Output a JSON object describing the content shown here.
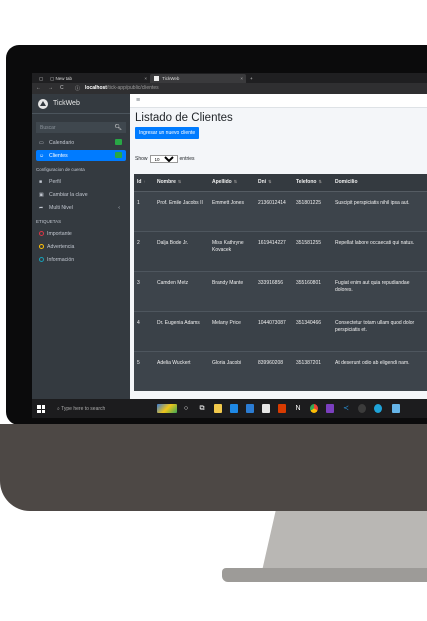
{
  "browser": {
    "tabs": [
      {
        "title": "New tab",
        "active": false
      },
      {
        "title": "TickWeb",
        "active": true
      }
    ],
    "new_tab_symbol": "+",
    "close_symbol": "×",
    "nav": {
      "back": "←",
      "forward": "→",
      "reload": "C",
      "info": "ⓘ"
    },
    "url_host": "localhost",
    "url_path": "/tick-app/public/clientes"
  },
  "sidebar": {
    "brand": "TickWeb",
    "search_placeholder": "Buscar",
    "items": [
      {
        "label": "Calendario",
        "icon": "calendar-icon",
        "badge_color": "#28a745",
        "active": false
      },
      {
        "label": "Clientes",
        "icon": "users-icon",
        "badge_color": "#28a745",
        "active": true
      }
    ],
    "config_header": "Configuracion de cuenta",
    "config_items": [
      {
        "label": "Perfil",
        "icon": "user-icon"
      },
      {
        "label": "Cambiar la clave",
        "icon": "lock-icon"
      },
      {
        "label": "Multi Nivel",
        "icon": "share-icon",
        "chevron": "‹"
      }
    ],
    "labels_header": "ETIQUETAS",
    "labels": [
      {
        "label": "Importante",
        "color": "#dc3545"
      },
      {
        "label": "Advertencia",
        "color": "#ffc107"
      },
      {
        "label": "Información",
        "color": "#17a2b8"
      }
    ]
  },
  "topnav": {
    "menu_symbol": "≡"
  },
  "main": {
    "title": "Listado de Clientes",
    "add_button": "Ingresar un nuevo cliente",
    "show_label": "Show",
    "show_value": "10",
    "entries_label": "entries",
    "table": {
      "headers": [
        "Id",
        "Nombre",
        "Apellido",
        "Dni",
        "Telefono",
        "Domicilio"
      ],
      "rows": [
        [
          "1",
          "Prof. Emile Jacobs II",
          "Emmett Jones",
          "2136012414",
          "351801225",
          "Suscipit perspiciatis nihil ipsa aut."
        ],
        [
          "2",
          "Dalja Bode Jr.",
          "Miss Kathryne Kovacek",
          "1619414227",
          "351581255",
          "Repellat labore occaecati qui natus."
        ],
        [
          "3",
          "Camden Metz",
          "Brandy Mante",
          "333916856",
          "355160801",
          "Fugiat enim aut quia repudiandae dolores."
        ],
        [
          "4",
          "Dr. Eugenia Adams",
          "Melany Price",
          "1044073087",
          "351340466",
          "Consectetur totam ullam quod dolor perspiciatis et."
        ],
        [
          "5",
          "Adelia Wuckert",
          "Gloria Jacobi",
          "839960208",
          "351387201",
          "At deserunt odio ab eligendi nam."
        ]
      ]
    }
  },
  "taskbar": {
    "search_placeholder": "Type here to search",
    "icons": [
      "start-icon",
      "task-view-icon",
      "widgets-icon",
      "file-explorer-icon",
      "mail-icon",
      "store-icon",
      "office-icon",
      "notion-icon",
      "chrome-icon",
      "visual-studio-icon",
      "vscode-icon",
      "copilot-icon",
      "edge-icon",
      "app-icon"
    ]
  },
  "colors": {
    "accent": "#007bff",
    "sidebar_bg": "#343a40",
    "table_bg": "#3a4148",
    "bezel": "#0b0b0c",
    "chin": "#4d4845",
    "stand": "#b9b7b4"
  }
}
